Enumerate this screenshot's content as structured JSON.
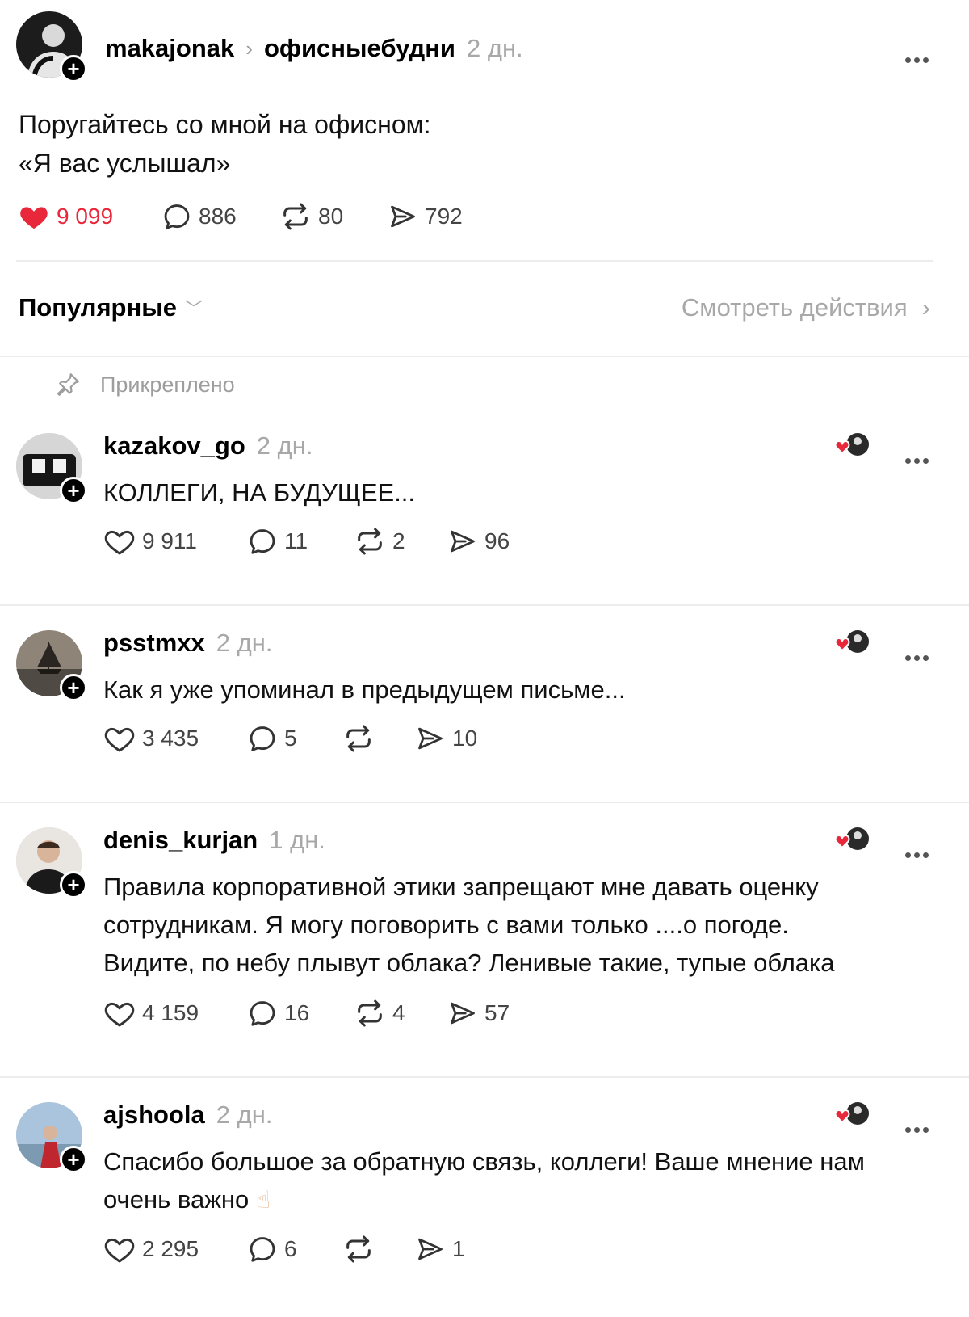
{
  "post": {
    "author": "makajonak",
    "community": "офисныебудни",
    "time": "2 дн.",
    "text_line1": "Поругайтесь со мной на офисном:",
    "text_line2": "«Я вас услышал»",
    "likes": "9 099",
    "comments": "886",
    "reposts": "80",
    "shares": "792"
  },
  "sort": {
    "label": "Популярные",
    "view_actions": "Смотреть действия"
  },
  "pinned_label": "Прикреплено",
  "replies": [
    {
      "author": "kazakov_go",
      "time": "2 дн.",
      "text": "КОЛЛЕГИ, НА БУДУЩЕЕ...",
      "likes": "9 911",
      "comments": "11",
      "reposts": "2",
      "shares": "96"
    },
    {
      "author": "psstmxx",
      "time": "2 дн.",
      "text": "Как я уже упоминал в предыдущем письме...",
      "likes": "3 435",
      "comments": "5",
      "reposts": "",
      "shares": "10"
    },
    {
      "author": "denis_kurjan",
      "time": "1 дн.",
      "text_line1": "Правила корпоративной этики запрещают мне давать оценку",
      "text_line2": "сотрудникам. Я могу поговорить с вами только ....о погоде.",
      "text_line3": "Видите, по небу плывут облака? Ленивые такие, тупые облака",
      "likes": "4 159",
      "comments": "16",
      "reposts": "4",
      "shares": "57"
    },
    {
      "author": "ajshoola",
      "time": "2 дн.",
      "text_line1": "Спасибо большое за обратную связь, коллеги! Ваше мнение нам",
      "text_line2": "очень важно",
      "emoji": "☝",
      "likes": "2 295",
      "comments": "6",
      "reposts": "",
      "shares": "1"
    }
  ],
  "colors": {
    "like_red": "#e8273a",
    "muted": "#a8a8a8",
    "divider": "#ececec"
  }
}
